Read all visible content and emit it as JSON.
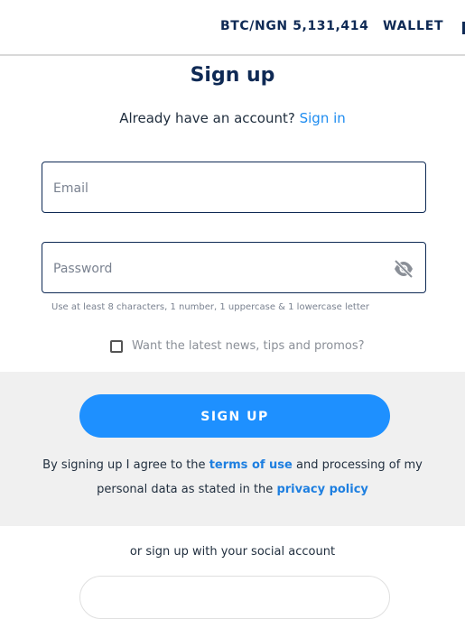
{
  "header": {
    "price_ticker": "BTC/NGN 5,131,414",
    "wallet_label": "WALLET"
  },
  "form": {
    "title": "Sign up",
    "signin_prompt": "Already have an account?",
    "signin_link": "Sign in",
    "email": {
      "placeholder": "Email",
      "value": ""
    },
    "password": {
      "placeholder": "Password",
      "value": "",
      "toggle_icon": "eye-off-icon"
    },
    "password_hint": "Use at least 8 characters, 1 number, 1 uppercase & 1 lowercase letter",
    "newsletter": {
      "label": "Want the latest news, tips and promos?",
      "checked": false
    },
    "submit_label": "SIGN UP",
    "legal": {
      "part1": "By signing up I agree to the",
      "terms_link": "terms of use",
      "part2": "and processing of my personal data as stated in the",
      "privacy_link": "privacy policy"
    },
    "social_prompt": "or sign up with your social account"
  },
  "colors": {
    "brand_navy": "#0f2a55",
    "accent_blue": "#1e90ff",
    "link_blue": "#1e8cf0",
    "band_gray": "#f0f0f0"
  }
}
